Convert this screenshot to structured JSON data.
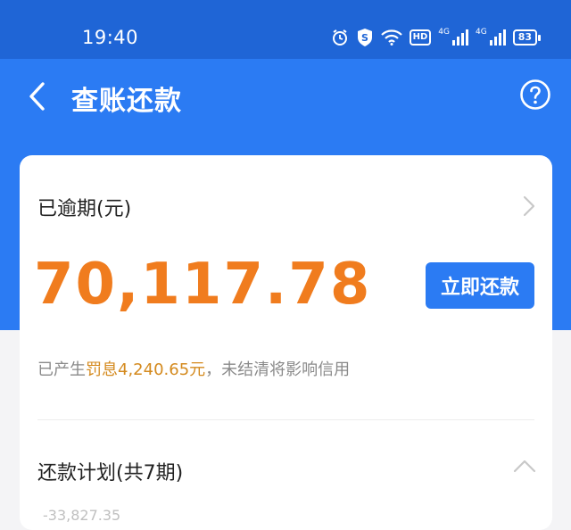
{
  "status_bar": {
    "time": "19:40",
    "icons": [
      "alarm-icon",
      "shield-s-icon",
      "wifi-icon",
      "hd-icon",
      "signal-4g-icon",
      "signal-4g-icon-2",
      "battery-icon"
    ],
    "hd_label": "HD",
    "network_1": "4G",
    "network_2": "4G",
    "battery": "83"
  },
  "header": {
    "title": "查账还款",
    "back_icon": "chevron-left-icon",
    "help_icon": "question-circle-icon"
  },
  "overdue": {
    "label": "已逾期(元)",
    "amount": "70,117.78",
    "pay_button": "立即还款",
    "notice_prefix": "已产生",
    "notice_highlight": "罚息4,240.65元",
    "notice_suffix": "，未结清将影响信用"
  },
  "plan": {
    "label": "还款计划(共7期)",
    "peek_text": "-33,827.35"
  },
  "colors": {
    "status_bar_bg": "#1f65d6",
    "brand_blue": "#2b7bf3",
    "amount_orange": "#f07c1e",
    "highlight_orange": "#d48a1e"
  }
}
